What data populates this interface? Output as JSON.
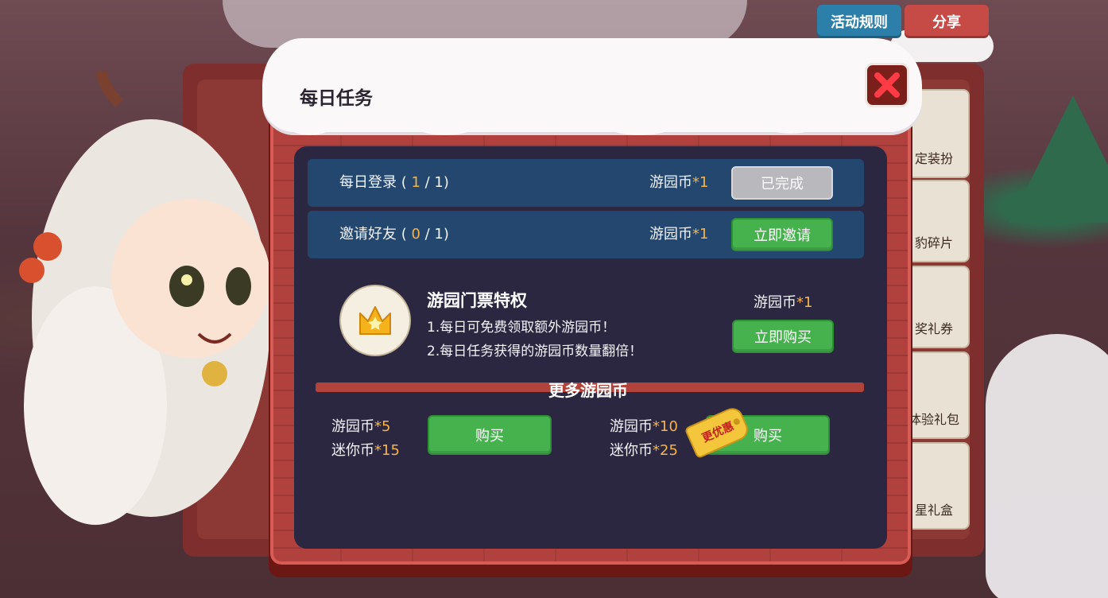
{
  "header": {
    "rules_label": "活动规则",
    "share_label": "分享"
  },
  "background_tiles": [
    "定装扮",
    "豹碎片",
    "奖礼券",
    "体验礼包",
    "星礼盒"
  ],
  "dialog": {
    "title": "每日任务",
    "close_icon": "close-x-icon",
    "tasks": [
      {
        "name": "每日登录",
        "progress_open": " ( ",
        "progress_current": "1",
        "progress_rest": " / 1)",
        "reward_label": "游园币",
        "reward_amount": "*1",
        "button_label": "已完成"
      },
      {
        "name": "邀请好友",
        "progress_open": " ( ",
        "progress_current": "0",
        "progress_rest": " / 1)",
        "reward_label": "游园币",
        "reward_amount": "*1",
        "button_label": "立即邀请"
      }
    ],
    "vip": {
      "icon": "crown-icon",
      "title": "游园门票特权",
      "line1": "1.每日可免费领取额外游园币！",
      "line2": "2.每日任务获得的游园币数量翻倍！",
      "reward_label": "游园币",
      "reward_amount": "*1",
      "button_label": "立即购买"
    },
    "more_title": "更多游园币",
    "packs": [
      {
        "coin_label": "游园币",
        "coin_amount": "*5",
        "mini_label": "迷你币",
        "mini_amount": "*15",
        "button_label": "购买"
      },
      {
        "coin_label": "游园币",
        "coin_amount": "*10",
        "mini_label": "迷你币",
        "mini_amount": "*25",
        "button_label": "购买",
        "tag": "更优惠"
      }
    ]
  },
  "colors": {
    "panel": "#2b2740",
    "task_row": "#23476e",
    "highlight": "#f4b44a",
    "green_button": "#46b24e",
    "done_button": "#b9b9bd",
    "frame": "#b0413d"
  }
}
